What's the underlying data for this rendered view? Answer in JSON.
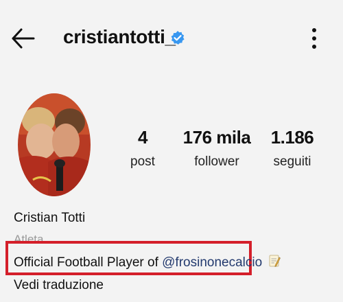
{
  "header": {
    "username": "cristiantotti_",
    "back_icon": "arrow-left-icon",
    "verified_icon": "verified-badge-icon",
    "more_icon": "more-vertical-icon"
  },
  "profile": {
    "avatar_icon": "profile-photo",
    "stats": [
      {
        "value": "4",
        "label": "post"
      },
      {
        "value": "176 mila",
        "label": "follower"
      },
      {
        "value": "1.186",
        "label": "seguiti"
      }
    ],
    "full_name": "Cristian Totti",
    "category": "Atleta",
    "bio": {
      "text": "Official Football Player of ",
      "mention": "@frosinonecalcio",
      "emoji_icon": "memo-icon"
    },
    "see_translation": "Vedi traduzione"
  },
  "colors": {
    "background": "#f3f3f3",
    "verified": "#3897f0",
    "highlight_border": "#d41f2a",
    "mention": "#233a6e",
    "category": "#9a9a9a"
  }
}
